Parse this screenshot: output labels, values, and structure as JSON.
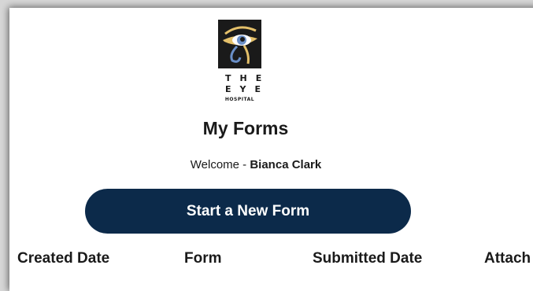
{
  "logo": {
    "line1": "THE",
    "line2": "EYE",
    "line3": "HOSPITAL",
    "icon": "eye-of-horus-icon",
    "colors": {
      "background": "#1a1a1a",
      "accent_gold": "#e4c06a",
      "accent_blue": "#6a8fc7"
    }
  },
  "page": {
    "title": "My Forms",
    "welcome_prefix": "Welcome - ",
    "user_name": "Bianca Clark"
  },
  "actions": {
    "start_label": "Start a New Form",
    "button_color": "#0c2a4a"
  },
  "table": {
    "columns": [
      "Created Date",
      "Form",
      "Submitted Date",
      "Attach"
    ]
  }
}
